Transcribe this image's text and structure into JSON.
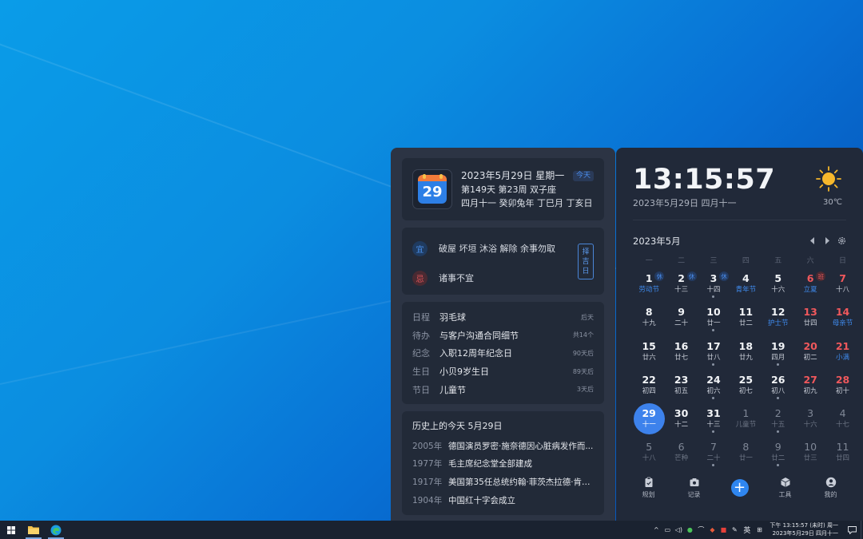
{
  "colors": {
    "accent": "#3d82ec",
    "weekend": "#f0585c",
    "holiday": "#3f8cf0",
    "panel_left": "#2c3444",
    "panel_right": "#212939"
  },
  "date_card": {
    "icon_day": "29",
    "line1": "2023年5月29日 星期一",
    "today_badge": "今天",
    "line2": "第149天 第23周 双子座",
    "line3": "四月十一 癸卯兔年 丁巳月 丁亥日"
  },
  "yiji": {
    "yi_label": "宜",
    "yi_text": "破屋 坏垣 沐浴 解除 余事勿取",
    "ji_label": "忌",
    "ji_text": "诸事不宜",
    "zeji_button": "择吉日"
  },
  "events": [
    {
      "type": "日程",
      "title": "羽毛球",
      "when": "后天"
    },
    {
      "type": "待办",
      "title": "与客户沟通合同细节",
      "when": "共14个"
    },
    {
      "type": "纪念",
      "title": "入职12周年纪念日",
      "when": "90天后"
    },
    {
      "type": "生日",
      "title": "小贝9岁生日",
      "when": "89天后"
    },
    {
      "type": "节日",
      "title": "儿童节",
      "when": "3天后"
    }
  ],
  "history": {
    "title": "历史上的今天 5月29日",
    "items": [
      {
        "year": "2005年",
        "text": "德国演员罗密·施奈德因心脏病发作而..."
      },
      {
        "year": "1977年",
        "text": "毛主席纪念堂全部建成"
      },
      {
        "year": "1917年",
        "text": "美国第35任总统约翰·菲茨杰拉德·肯尼..."
      },
      {
        "year": "1904年",
        "text": "中国红十字会成立"
      }
    ]
  },
  "clock": {
    "time": "13:15:57",
    "date": "2023年5月29日 四月十一",
    "weather_icon": "sun-icon",
    "temperature": "30℃"
  },
  "calendar": {
    "month_label": "2023年5月",
    "weekdays": [
      "一",
      "二",
      "三",
      "四",
      "五",
      "六",
      "日"
    ],
    "days": [
      {
        "d": "1",
        "sub": "劳动节",
        "holiday": true,
        "tag": "休"
      },
      {
        "d": "2",
        "sub": "十三",
        "tag": "休"
      },
      {
        "d": "3",
        "sub": "十四",
        "tag": "休",
        "dot": true
      },
      {
        "d": "4",
        "sub": "青年节",
        "holiday": true
      },
      {
        "d": "5",
        "sub": "十六"
      },
      {
        "d": "6",
        "sub": "立夏",
        "holiday": true,
        "weekend": true,
        "tag": "班",
        "tagType": "work"
      },
      {
        "d": "7",
        "sub": "十八",
        "weekend": true
      },
      {
        "d": "8",
        "sub": "十九"
      },
      {
        "d": "9",
        "sub": "二十"
      },
      {
        "d": "10",
        "sub": "廿一",
        "dot": true
      },
      {
        "d": "11",
        "sub": "廿二"
      },
      {
        "d": "12",
        "sub": "护士节",
        "holiday": true
      },
      {
        "d": "13",
        "sub": "廿四",
        "weekend": true
      },
      {
        "d": "14",
        "sub": "母亲节",
        "holiday": true,
        "weekend": true
      },
      {
        "d": "15",
        "sub": "廿六"
      },
      {
        "d": "16",
        "sub": "廿七"
      },
      {
        "d": "17",
        "sub": "廿八",
        "dot": true
      },
      {
        "d": "18",
        "sub": "廿九"
      },
      {
        "d": "19",
        "sub": "四月",
        "dot": true
      },
      {
        "d": "20",
        "sub": "初二",
        "weekend": true
      },
      {
        "d": "21",
        "sub": "小满",
        "holiday": true,
        "weekend": true
      },
      {
        "d": "22",
        "sub": "初四"
      },
      {
        "d": "23",
        "sub": "初五"
      },
      {
        "d": "24",
        "sub": "初六",
        "dot": true
      },
      {
        "d": "25",
        "sub": "初七"
      },
      {
        "d": "26",
        "sub": "初八",
        "dot": true
      },
      {
        "d": "27",
        "sub": "初九",
        "weekend": true
      },
      {
        "d": "28",
        "sub": "初十",
        "weekend": true
      },
      {
        "d": "29",
        "sub": "十一",
        "today": true
      },
      {
        "d": "30",
        "sub": "十二"
      },
      {
        "d": "31",
        "sub": "十三",
        "dot": true
      },
      {
        "d": "1",
        "sub": "儿童节",
        "other": true
      },
      {
        "d": "2",
        "sub": "十五",
        "other": true,
        "dot": true
      },
      {
        "d": "3",
        "sub": "十六",
        "other": true
      },
      {
        "d": "4",
        "sub": "十七",
        "other": true
      },
      {
        "d": "5",
        "sub": "十八",
        "other": true
      },
      {
        "d": "6",
        "sub": "芒种",
        "other": true
      },
      {
        "d": "7",
        "sub": "二十",
        "other": true,
        "dot": true
      },
      {
        "d": "8",
        "sub": "廿一",
        "other": true
      },
      {
        "d": "9",
        "sub": "廿二",
        "other": true,
        "dot": true
      },
      {
        "d": "10",
        "sub": "廿三",
        "other": true
      },
      {
        "d": "11",
        "sub": "廿四",
        "other": true
      }
    ]
  },
  "bottom_nav": [
    {
      "label": "规划",
      "icon": "clipboard-icon"
    },
    {
      "label": "记录",
      "icon": "camera-icon"
    },
    {
      "label": "",
      "icon": "add-icon"
    },
    {
      "label": "工具",
      "icon": "cube-icon"
    },
    {
      "label": "我的",
      "icon": "user-icon"
    }
  ],
  "taskbar": {
    "ime": "英",
    "clock_line1": "下午 13:15:57 (未时) 周一",
    "clock_line2": "2023年5月29日 四月十一"
  }
}
